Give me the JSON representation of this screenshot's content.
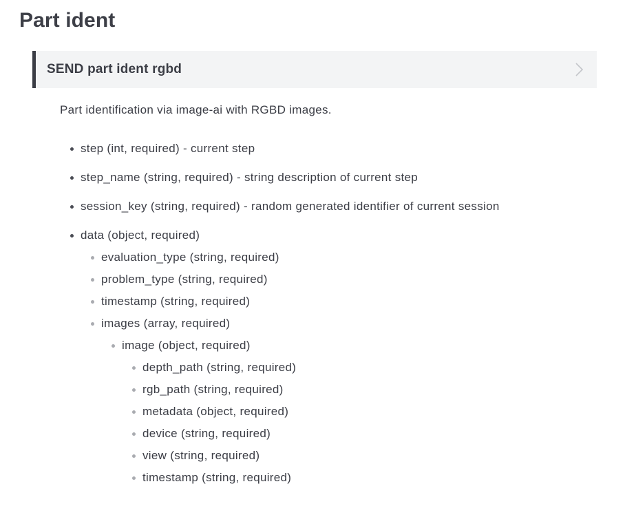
{
  "page": {
    "title": "Part ident"
  },
  "section": {
    "title": "SEND part ident rgbd",
    "chevron_icon": "chevron-right-icon",
    "description": "Part identification via image-ai with RGBD images."
  },
  "params": [
    {
      "text": "step (int, required) - current step",
      "level": 1
    },
    {
      "text": "step_name (string, required) - string description of current step",
      "level": 1
    },
    {
      "text": "session_key (string, required) - random generated identifier of current session",
      "level": 1
    },
    {
      "text": "data (object, required)",
      "level": 1
    },
    {
      "text": "evaluation_type (string, required)",
      "level": 2
    },
    {
      "text": "problem_type (string, required)",
      "level": 2
    },
    {
      "text": "timestamp (string, required)",
      "level": 2
    },
    {
      "text": "images (array, required)",
      "level": 2
    },
    {
      "text": "image (object, required)",
      "level": 3
    },
    {
      "text": "depth_path (string, required)",
      "level": 4
    },
    {
      "text": "rgb_path (string, required)",
      "level": 4
    },
    {
      "text": "metadata (object, required)",
      "level": 4
    },
    {
      "text": "device (string, required)",
      "level": 4
    },
    {
      "text": "view (string, required)",
      "level": 4
    },
    {
      "text": "timestamp (string, required)",
      "level": 4
    }
  ]
}
